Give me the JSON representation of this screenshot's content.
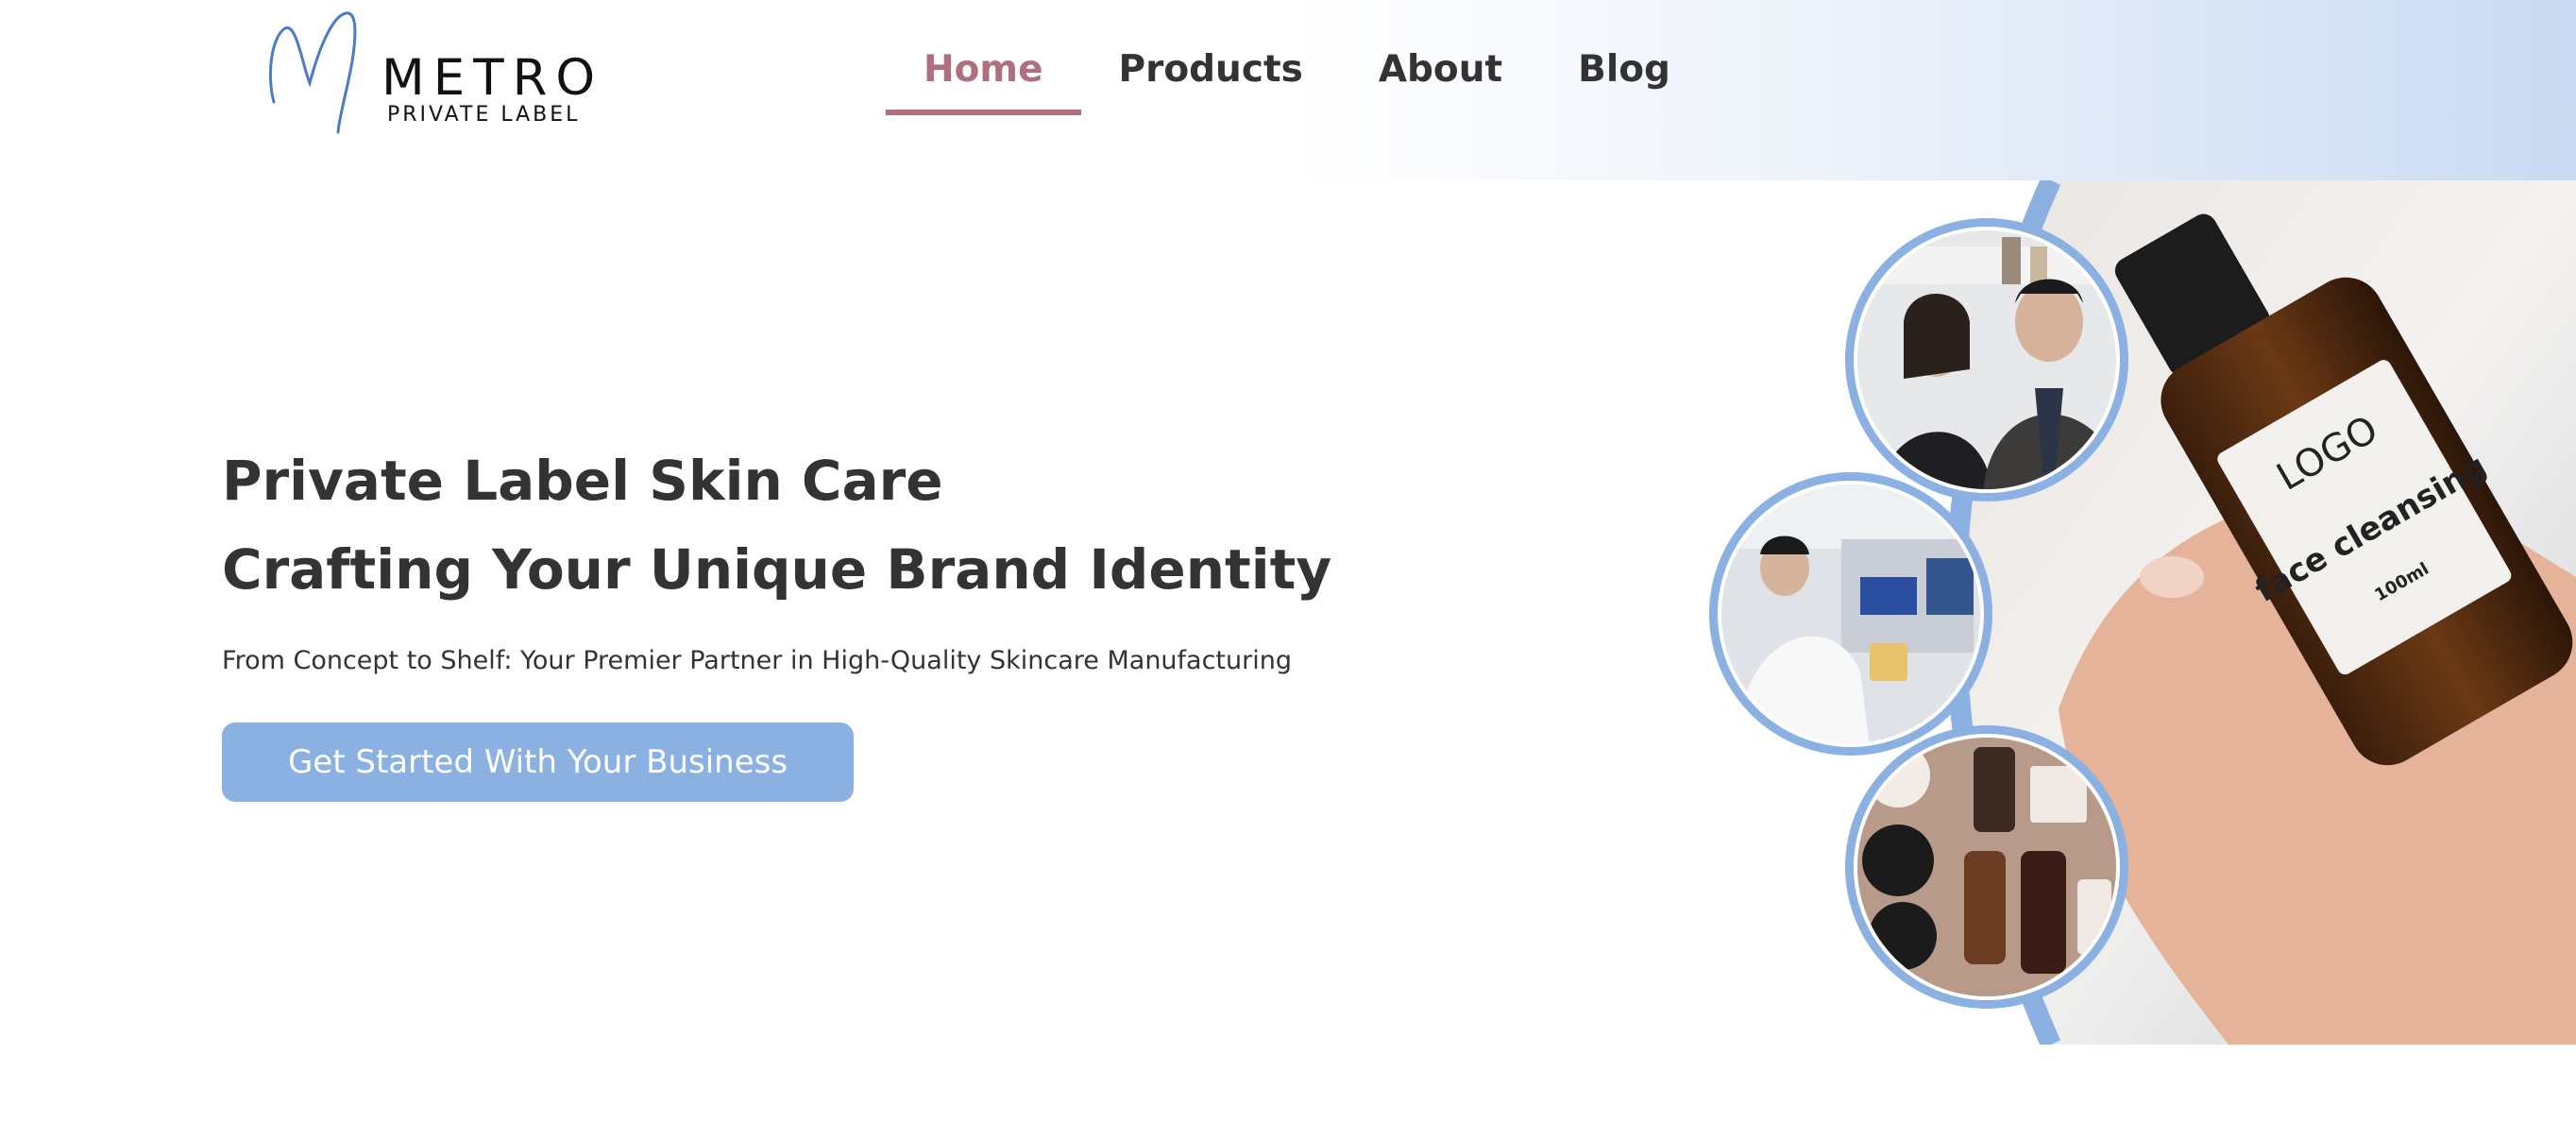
{
  "brand": {
    "name": "METRO",
    "tagline": "PRIVATE LABEL",
    "logo_color": "#4a7cc7"
  },
  "nav": {
    "items": [
      {
        "label": "Home",
        "active": true
      },
      {
        "label": "Products",
        "active": false
      },
      {
        "label": "About",
        "active": false
      },
      {
        "label": "Blog",
        "active": false
      }
    ],
    "active_color": "#b06f7d"
  },
  "hero": {
    "title_line1": "Private Label Skin Care",
    "title_line2": "Crafting Your Unique Brand Identity",
    "subtitle": "From Concept to Shelf: Your Premier Partner in High-Quality Skincare Manufacturing",
    "cta_label": "Get Started With Your Business",
    "cta_color": "#8ab1e2"
  },
  "product_photo": {
    "label_logo": "LOGO",
    "label_name": "face cleansing",
    "label_volume": "100ml"
  },
  "accent_color": "#8ab1e2"
}
